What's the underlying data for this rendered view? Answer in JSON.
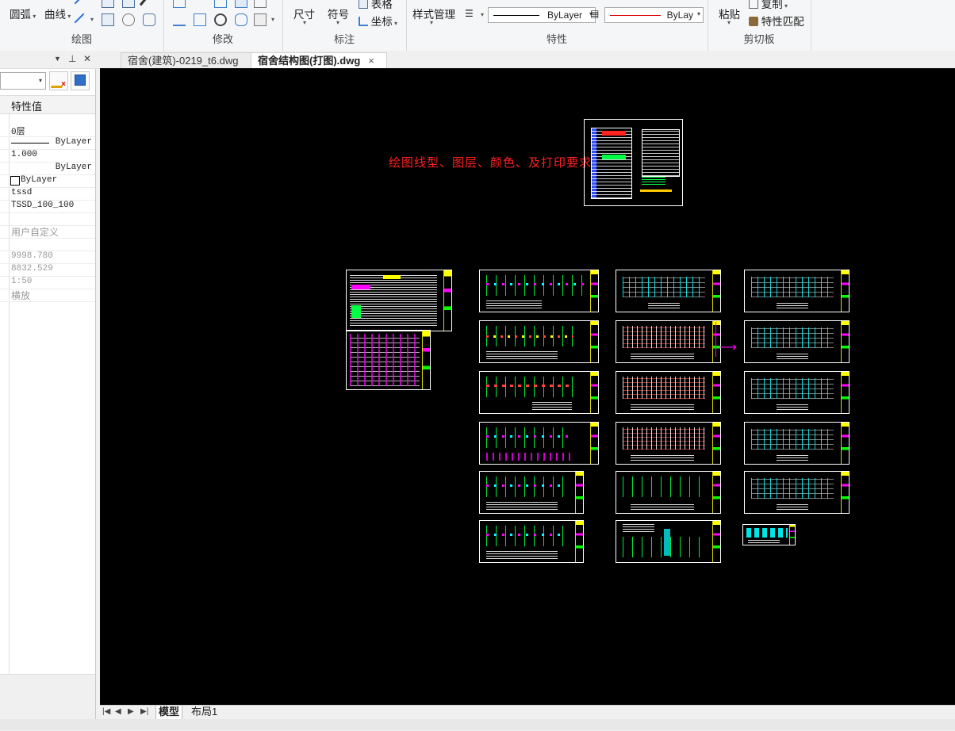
{
  "ribbon": {
    "groups": [
      {
        "name": "绘图",
        "buttons": [
          "圆弧",
          "曲线"
        ]
      },
      {
        "name": "修改"
      },
      {
        "name": "标注",
        "buttons": [
          "尺寸",
          "符号",
          "表格",
          "坐标"
        ]
      },
      {
        "name": "特性",
        "style_manager": "样式管理",
        "linetype": "ByLayer",
        "color": "ByLay"
      },
      {
        "name": "剪切板",
        "paste": "粘贴",
        "copy": "复制",
        "match": "特性匹配"
      }
    ]
  },
  "palette": {
    "header": "特性值",
    "rows": [
      {
        "value": "0层",
        "style": "normal"
      },
      {
        "value": "ByLayer",
        "style": "linetype"
      },
      {
        "value": "1.000",
        "style": "normal"
      },
      {
        "value": "ByLayer",
        "style": "right"
      },
      {
        "value": "ByLayer",
        "style": "check"
      },
      {
        "value": "tssd",
        "style": "normal"
      },
      {
        "value": "TSSD_100_100",
        "style": "normal"
      },
      {
        "value": "",
        "style": "normal"
      },
      {
        "value": "用户自定义",
        "style": "gray"
      },
      {
        "value": "",
        "style": "normal"
      },
      {
        "value": "9998.780",
        "style": "gray"
      },
      {
        "value": "8832.529",
        "style": "gray"
      },
      {
        "value": "1:50",
        "style": "gray"
      },
      {
        "value": "横放",
        "style": "gray"
      }
    ]
  },
  "tabs": [
    {
      "label": "宿舍(建筑)-0219_t6.dwg",
      "active": false
    },
    {
      "label": "宿舍结构图(打图).dwg",
      "active": true,
      "close": "×"
    }
  ],
  "canvas": {
    "note_text": "绘图线型、图层、颜色、及打印要求"
  },
  "bottom_tabs": [
    {
      "label": "模型",
      "active": true
    },
    {
      "label": "布局1",
      "active": false
    }
  ],
  "colors": {
    "canvas_bg": "#000000",
    "note_red": "#ff2020",
    "sheet_green": "#00ff44",
    "titleblock_yellow": "#ffff00",
    "magenta": "#ff00ff"
  }
}
